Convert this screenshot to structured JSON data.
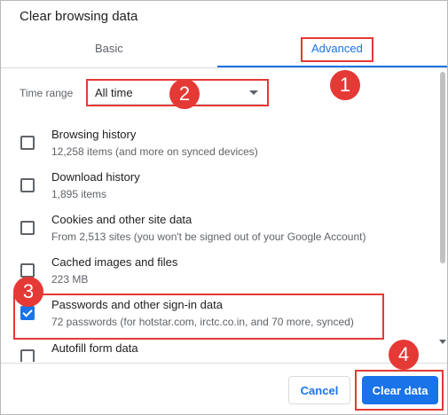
{
  "dialog": {
    "title": "Clear browsing data",
    "tabs": [
      {
        "label": "Basic"
      },
      {
        "label": "Advanced"
      }
    ]
  },
  "time_range": {
    "label": "Time range",
    "value": "All time"
  },
  "items": [
    {
      "title": "Browsing history",
      "subtitle": "12,258 items (and more on synced devices)",
      "checked": false
    },
    {
      "title": "Download history",
      "subtitle": "1,895 items",
      "checked": false
    },
    {
      "title": "Cookies and other site data",
      "subtitle": "From 2,513 sites (you won't be signed out of your Google Account)",
      "checked": false
    },
    {
      "title": "Cached images and files",
      "subtitle": "223 MB",
      "checked": false
    },
    {
      "title": "Passwords and other sign-in data",
      "subtitle": "72 passwords (for hotstar.com, irctc.co.in, and 70 more, synced)",
      "checked": true
    },
    {
      "title": "Autofill form data",
      "subtitle": "",
      "checked": false
    }
  ],
  "footer": {
    "cancel_label": "Cancel",
    "clear_label": "Clear data"
  },
  "annotations": {
    "badge_1": "1",
    "badge_2": "2",
    "badge_3": "3",
    "badge_4": "4"
  },
  "colors": {
    "accent": "#1a73e8",
    "highlight": "#e53935"
  }
}
